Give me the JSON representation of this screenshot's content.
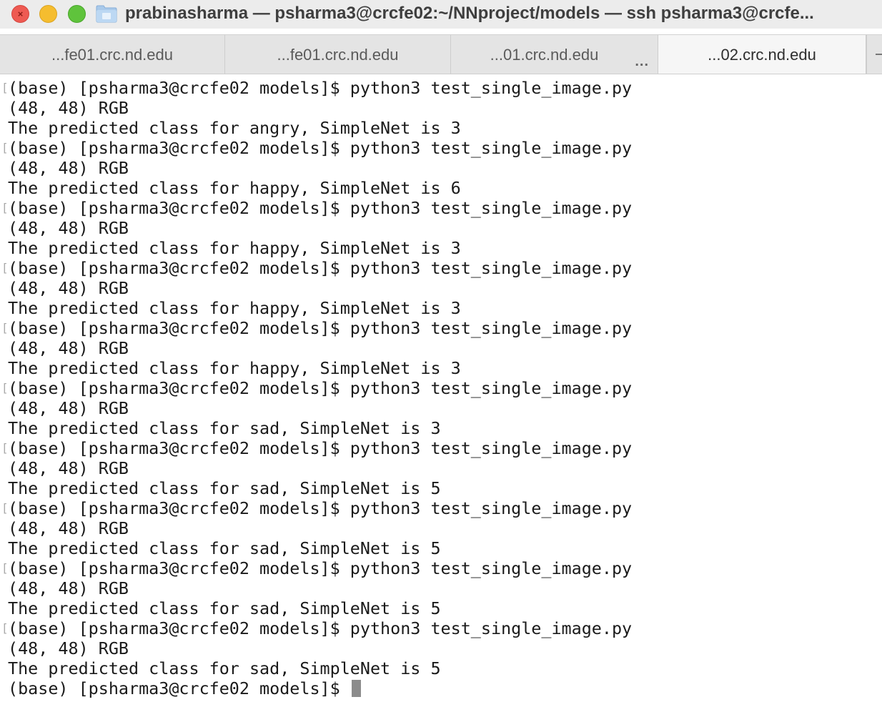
{
  "window": {
    "title": "prabinasharma — psharma3@crcfe02:~/NNproject/models — ssh psharma3@crcfe...",
    "controls": [
      "close",
      "minimize",
      "zoom"
    ],
    "title_icon": "folder-icon"
  },
  "tabs": [
    {
      "label": "...fe01.crc.nd.edu",
      "active": false
    },
    {
      "label": "...fe01.crc.nd.edu",
      "active": false
    },
    {
      "label": "...01.crc.nd.edu",
      "active": false
    },
    {
      "label": "...02.crc.nd.edu",
      "active": true
    }
  ],
  "tab_overflow": "...",
  "colors": {
    "close": "#ee5a52",
    "minimize": "#f5bd2f",
    "zoom": "#5fc33c",
    "cursor": "#8c8c8c"
  },
  "terminal": {
    "lines": [
      "(base) [psharma3@crcfe02 models]$ python3 test_single_image.py",
      "(48, 48) RGB",
      "The predicted class for angry, SimpleNet is 3",
      "(base) [psharma3@crcfe02 models]$ python3 test_single_image.py",
      "(48, 48) RGB",
      "The predicted class for happy, SimpleNet is 6",
      "(base) [psharma3@crcfe02 models]$ python3 test_single_image.py",
      "(48, 48) RGB",
      "The predicted class for happy, SimpleNet is 3",
      "(base) [psharma3@crcfe02 models]$ python3 test_single_image.py",
      "(48, 48) RGB",
      "The predicted class for happy, SimpleNet is 3",
      "(base) [psharma3@crcfe02 models]$ python3 test_single_image.py",
      "(48, 48) RGB",
      "The predicted class for happy, SimpleNet is 3",
      "(base) [psharma3@crcfe02 models]$ python3 test_single_image.py",
      "(48, 48) RGB",
      "The predicted class for sad, SimpleNet is 3",
      "(base) [psharma3@crcfe02 models]$ python3 test_single_image.py",
      "(48, 48) RGB",
      "The predicted class for sad, SimpleNet is 5",
      "(base) [psharma3@crcfe02 models]$ python3 test_single_image.py",
      "(48, 48) RGB",
      "The predicted class for sad, SimpleNet is 5",
      "(base) [psharma3@crcfe02 models]$ python3 test_single_image.py",
      "(48, 48) RGB",
      "The predicted class for sad, SimpleNet is 5",
      "(base) [psharma3@crcfe02 models]$ python3 test_single_image.py",
      "(48, 48) RGB",
      "The predicted class for sad, SimpleNet is 5",
      "(base) [psharma3@crcfe02 models]$ "
    ]
  }
}
